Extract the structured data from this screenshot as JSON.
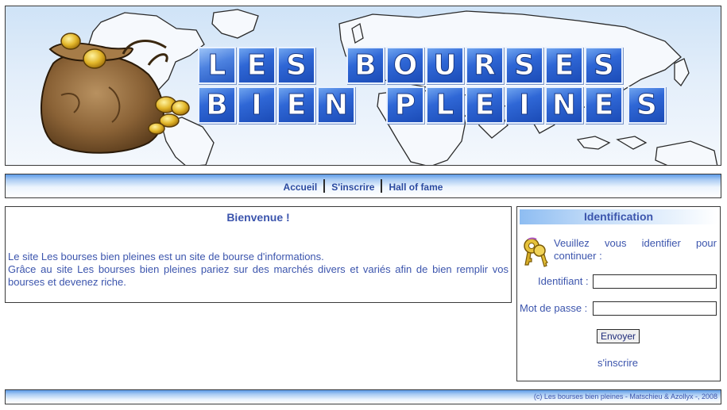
{
  "banner": {
    "logo_text": "Les bourses bien pleines",
    "line1": [
      "L",
      "E",
      "S",
      "B",
      "O",
      "U",
      "R",
      "S",
      "E",
      "S"
    ],
    "line2": [
      "B",
      "I",
      "E",
      "N",
      "P",
      "L",
      "E",
      "I",
      "N",
      "E",
      "S"
    ],
    "icons": [
      "money-bag-icon",
      "world-map-icon"
    ]
  },
  "nav": {
    "items": [
      {
        "label": "Accueil"
      },
      {
        "label": "S'inscrire"
      },
      {
        "label": "Hall of fame"
      }
    ]
  },
  "welcome": {
    "title": "Bienvenue !",
    "paragraph1": "Le site Les bourses bien pleines est un site de bourse d'informations.",
    "paragraph2": "Grâce au site Les bourses bien pleines pariez sur des marchés divers et variés afin de bien remplir vos bourses et devenez riche."
  },
  "identification": {
    "title": "Identification",
    "message": "Veuillez vous identifier pour continuer :",
    "username_label": "Identifiant :",
    "username_value": "",
    "password_label": "Mot de passe :",
    "password_value": "",
    "submit_label": "Envoyer",
    "register_link": "s'inscrire",
    "icon": "keys-icon"
  },
  "footer": {
    "copyright": "(c) Les bourses bien pleines - Matschieu & Azollyx -, 2008"
  },
  "colors": {
    "text": "#3c55ad",
    "tile_blue": "#2f67d6",
    "bar_blue": "#5d9be8",
    "border": "#3a3a3a"
  }
}
